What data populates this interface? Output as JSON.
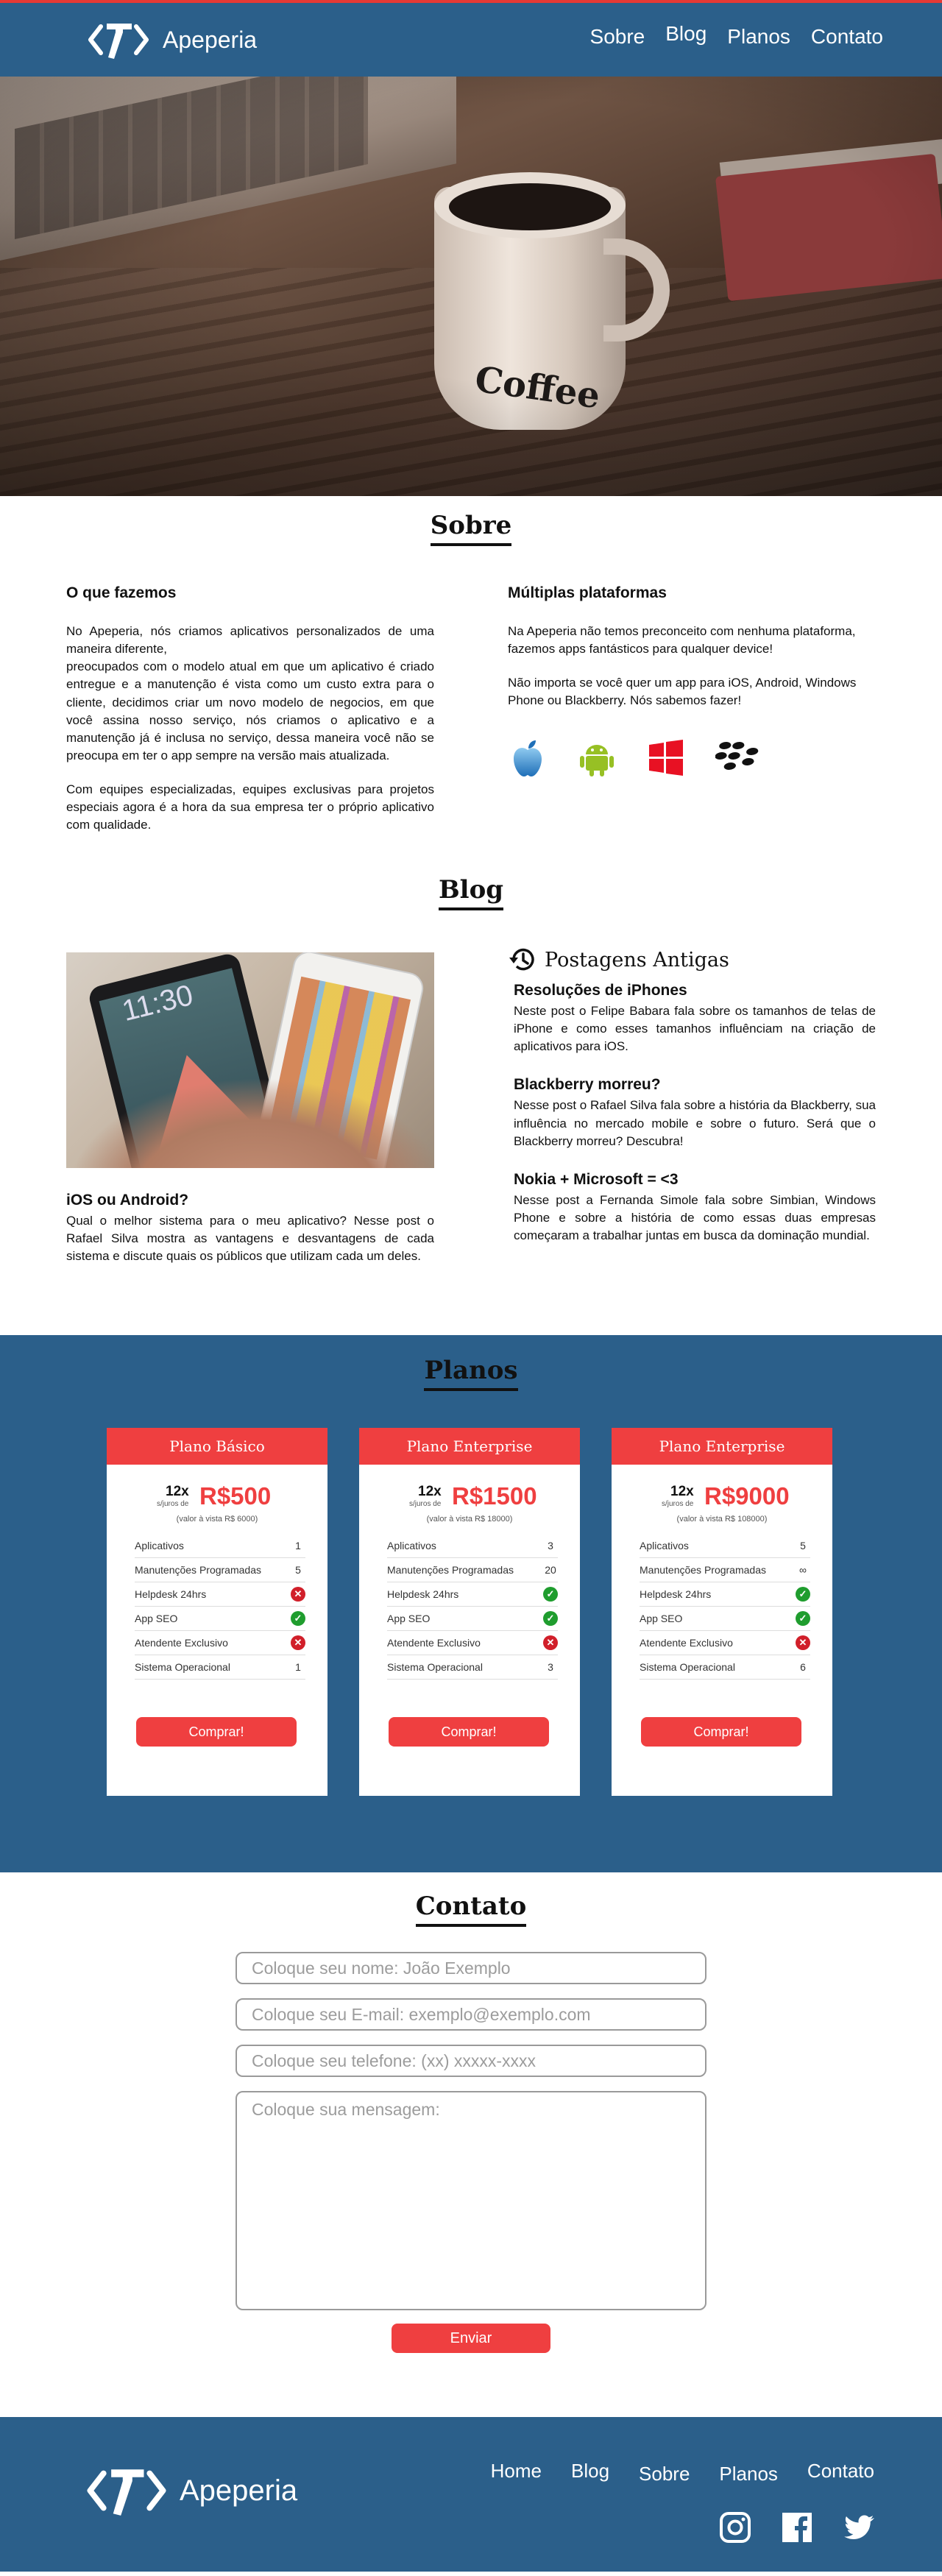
{
  "header": {
    "brand": "Apeperia",
    "nav": [
      "Sobre",
      "Blog",
      "Planos",
      "Contato"
    ]
  },
  "sobre": {
    "title": "Sobre",
    "left": {
      "heading": "O que fazemos",
      "p1": "No Apeperia, nós criamos aplicativos personalizados de uma maneira diferente,",
      "p2": "preocupados com o modelo atual em que um aplicativo é criado entregue e a manutenção é vista como um custo extra para o cliente, decidimos criar um novo modelo de negocios, em que você assina nosso serviço, nós criamos o aplicativo e a manutenção já é inclusa no serviço, dessa maneira você não se preocupa em ter o app sempre na versão mais atualizada.",
      "p3": "Com equipes especializadas, equipes exclusivas para projetos especiais agora é a hora da sua empresa ter o próprio aplicativo com qualidade."
    },
    "right": {
      "heading": "Múltiplas plataformas",
      "p1": "Na Apeperia não temos preconceito com nenhuma plataforma, fazemos apps fantásticos para qualquer device!",
      "p2": "Não importa se você quer um app para iOS, Android, Windows Phone ou Blackberry. Nós sabemos fazer!"
    }
  },
  "blog": {
    "title": "Blog",
    "featured": {
      "title": "iOS ou Android?",
      "text": "Qual o melhor sistema para o meu aplicativo? Nesse post o Rafael Silva mostra as vantagens e desvantagens de cada sistema e discute quais os públicos que utilizam cada um deles."
    },
    "old_title": "Postagens Antigas",
    "posts": [
      {
        "title": "Resoluções de iPhones",
        "text": "Neste post o Felipe Babara fala sobre os tamanhos de telas de iPhone e como esses tamanhos influênciam na criação de aplicativos para iOS."
      },
      {
        "title": "Blackberry morreu?",
        "text": "Nesse post o Rafael Silva fala sobre a história da Blackberry, sua influência no mercado mobile e sobre o futuro. Será que o Blackberry morreu? Descubra!"
      },
      {
        "title": "Nokia + Microsoft = <3",
        "text": "Nesse post a Fernanda Simole fala sobre Simbian, Windows Phone e sobre a história de como essas duas empresas começaram a trabalhar juntas em busca da dominação mundial."
      }
    ]
  },
  "planos": {
    "title": "Planos",
    "plans": [
      {
        "name": "Plano Básico",
        "installments": "12x",
        "interest": "s/juros de",
        "price": "R$500",
        "cash": "(valor à vista R$ 6000)",
        "features": [
          [
            "Aplicativos",
            "1"
          ],
          [
            "Manutenções Programadas",
            "5"
          ],
          [
            "Helpdesk 24hrs",
            "no"
          ],
          [
            "App SEO",
            "yes"
          ],
          [
            "Atendente Exclusivo",
            "no"
          ],
          [
            "Sistema Operacional",
            "1"
          ]
        ],
        "button": "Comprar!"
      },
      {
        "name": "Plano Enterprise",
        "installments": "12x",
        "interest": "s/juros de",
        "price": "R$1500",
        "cash": "(valor à vista R$ 18000)",
        "features": [
          [
            "Aplicativos",
            "3"
          ],
          [
            "Manutenções Programadas",
            "20"
          ],
          [
            "Helpdesk 24hrs",
            "yes"
          ],
          [
            "App SEO",
            "yes"
          ],
          [
            "Atendente Exclusivo",
            "no"
          ],
          [
            "Sistema Operacional",
            "3"
          ]
        ],
        "button": "Comprar!"
      },
      {
        "name": "Plano Enterprise",
        "installments": "12x",
        "interest": "s/juros de",
        "price": "R$9000",
        "cash": "(valor à vista R$ 108000)",
        "features": [
          [
            "Aplicativos",
            "5"
          ],
          [
            "Manutenções Programadas",
            "∞"
          ],
          [
            "Helpdesk 24hrs",
            "yes"
          ],
          [
            "App SEO",
            "yes"
          ],
          [
            "Atendente Exclusivo",
            "no"
          ],
          [
            "Sistema Operacional",
            "6"
          ]
        ],
        "button": "Comprar!"
      }
    ]
  },
  "contato": {
    "title": "Contato",
    "name_placeholder": "Coloque seu nome: João Exemplo",
    "email_placeholder": "Coloque seu E-mail: exemplo@exemplo.com",
    "phone_placeholder": "Coloque seu telefone: (xx) xxxxx-xxxx",
    "message_placeholder": "Coloque sua mensagem:",
    "send": "Enviar"
  },
  "footer": {
    "brand": "Apeperia",
    "nav": [
      "Home",
      "Blog",
      "Sobre",
      "Planos",
      "Contato"
    ]
  },
  "colors": {
    "primary": "#2b5f8a",
    "accent": "#ef3f40"
  }
}
